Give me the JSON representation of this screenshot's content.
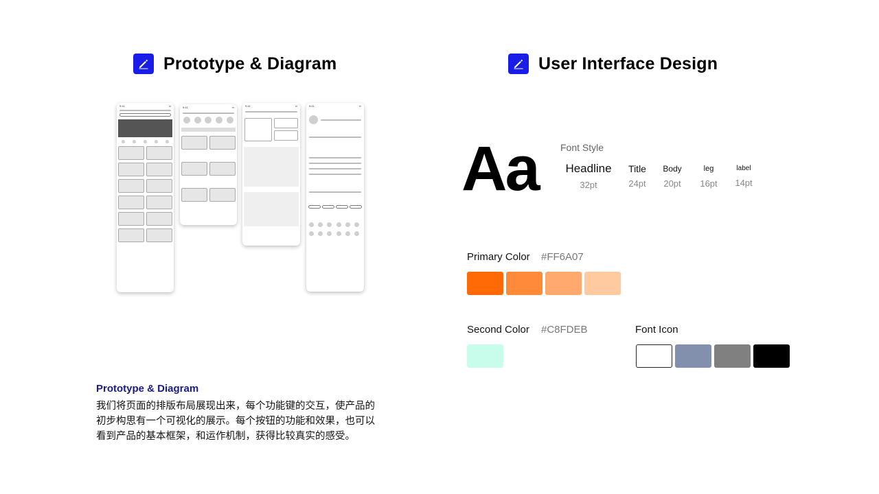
{
  "left": {
    "heading": "Prototype & Diagram",
    "section_label": "Prototype & Diagram",
    "description": "我们将页面的排版布局展现出来，每个功能键的交互，使产品的初步构思有一个可视化的展示。每个按钮的功能和效果，也可以看到产品的基本框架，和运作机制，获得比较真实的感受。"
  },
  "right": {
    "heading": "User Interface Design",
    "sample_glyph": "Aa",
    "font_style_title": "Font Style",
    "type_scale": [
      {
        "name": "Headline",
        "size": "32pt"
      },
      {
        "name": "Title",
        "size": "24pt"
      },
      {
        "name": "Body",
        "size": "20pt"
      },
      {
        "name": "leg",
        "size": "16pt"
      },
      {
        "name": "label",
        "size": "14pt"
      }
    ],
    "primary": {
      "label": "Primary  Color",
      "hex": "#FF6A07",
      "swatches": [
        "#ff6a07",
        "#ff8a3a",
        "#ffa96e",
        "#ffcaa0"
      ]
    },
    "second": {
      "label": "Second Color",
      "hex": "#C8FDEB",
      "swatches": [
        "#c8fdeb"
      ]
    },
    "font_icon": {
      "label": "Font Icon",
      "swatches": [
        "#ffffff",
        "#8390ad",
        "#808080",
        "#000000"
      ]
    }
  },
  "icons": {
    "heading_icon": "edit-pencil-icon",
    "accent": "#1a1de8"
  }
}
